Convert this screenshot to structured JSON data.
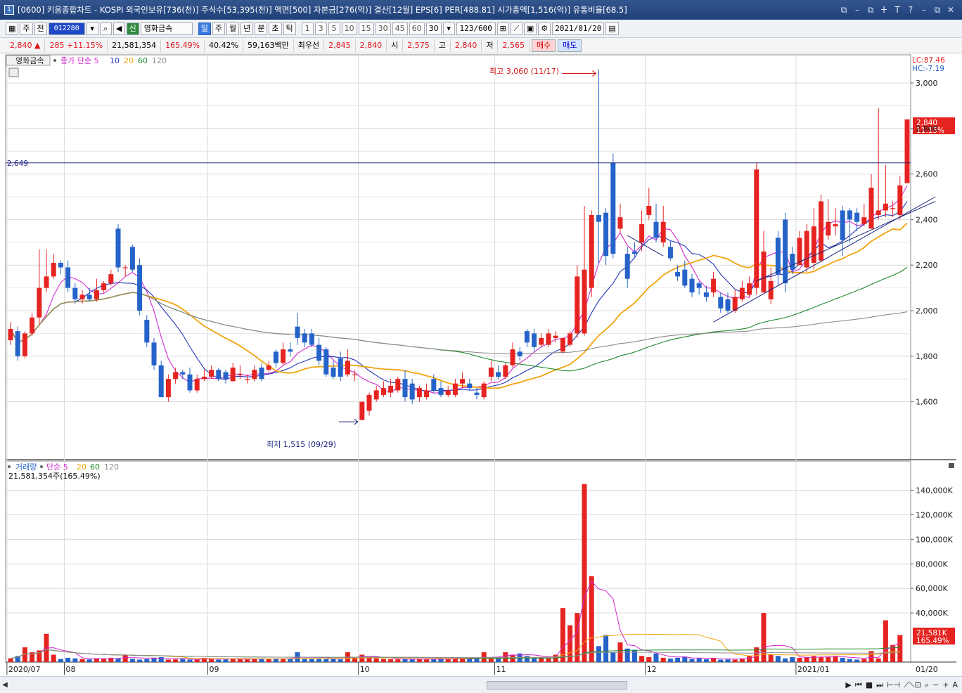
{
  "window": {
    "title": "[0600] 키움종합차트 - KOSPI 외국인보유[736(천)] 주식수[53,395(천)] 액면[500] 자본금[276(억)] 결산[12월] EPS[6] PER[488.81] 시가총액[1,516(억)] 유통비율[68.5]",
    "app_badge": "1",
    "controls": [
      "⧉",
      "–",
      "⧉",
      "ⵜ",
      "T",
      "?",
      "–",
      "⧉",
      "✕"
    ]
  },
  "toolbar": {
    "type": "주",
    "prev": "전",
    "code": "012280",
    "name_tag": "신",
    "name": "영화금속",
    "periods": [
      "일",
      "주",
      "월",
      "년",
      "분",
      "초",
      "틱"
    ],
    "active_period": "일",
    "intervals": [
      "1",
      "3",
      "5",
      "10",
      "15",
      "30",
      "45",
      "60"
    ],
    "interval_value": "30",
    "count": "123/600",
    "date": "2021/01/20"
  },
  "quote": {
    "price": "2,840 ▲",
    "change": "285 +11.15%",
    "volume": "21,581,354",
    "volume_ratio": "165.49%",
    "turnover": "40.42%",
    "amount": "59,163백만",
    "priority_label": "최우선",
    "ask": "2,845",
    "bid": "2,840",
    "open_label": "시",
    "open": "2,575",
    "high_label": "고",
    "high": "2,840",
    "low_label": "저",
    "low": "2,565",
    "buy_label": "매수",
    "sell_label": "매도"
  },
  "colors": {
    "up": "#e52421",
    "down": "#2563c9",
    "ma5": "#d02ad0",
    "ma10": "#2537b8",
    "ma20": "#f0a410",
    "ma60": "#1f8a2a",
    "ma120": "#8c8c8c",
    "hline": "#1a237e"
  },
  "price_panel": {
    "legend_name": "영화금속",
    "legend_ma": [
      "종가 단순 5",
      "10",
      "20",
      "60",
      "120"
    ],
    "lc": "LC:87.46",
    "hc": "HC:-7.19",
    "hline_value": 2649,
    "hline_label": "2,649",
    "high_annotation": "최고 3,060 (11/17)",
    "low_annotation": "최저 1,515 (09/29)",
    "last_price_label": "2,840",
    "last_change_label": "11.15%",
    "y_ticks": [
      "3,000",
      "2,800",
      "2,600",
      "2,400",
      "2,200",
      "2,000",
      "1,800",
      "1,600"
    ]
  },
  "volume_panel": {
    "legend_name": "거래량",
    "legend_ma": [
      "단순 5",
      "20",
      "60",
      "120"
    ],
    "current": "21,581,354주(165.49%)",
    "last_label": "21,581K",
    "last_ratio": "165.49%",
    "y_ticks": [
      "140,000K",
      "120,000K",
      "100,000K",
      "80,000K",
      "60,000K",
      "40,000K"
    ]
  },
  "x_labels": [
    "2020/07",
    "08",
    "09",
    "10",
    "11",
    "12",
    "2021/01",
    "01/20"
  ],
  "chart_data": {
    "type": "candlestick",
    "ylim": [
      1500,
      3000
    ],
    "volume_ylim": [
      0,
      150000
    ],
    "months": [
      {
        "label": "2020/07",
        "start_index": 0
      },
      {
        "label": "08",
        "start_index": 8
      },
      {
        "label": "09",
        "start_index": 28
      },
      {
        "label": "10",
        "start_index": 49
      },
      {
        "label": "11",
        "start_index": 68
      },
      {
        "label": "12",
        "start_index": 89
      },
      {
        "label": "2021/01",
        "start_index": 110
      }
    ],
    "open": [
      1870,
      1910,
      1800,
      1900,
      1970,
      2100,
      2150,
      2210,
      2190,
      2100,
      2050,
      2070,
      2050,
      2090,
      2120,
      2360,
      2190,
      2280,
      2200,
      1960,
      1860,
      1760,
      1620,
      1700,
      1730,
      1720,
      1650,
      1700,
      1710,
      1740,
      1730,
      1690,
      1720,
      1700,
      1700,
      1750,
      1740,
      1820,
      1770,
      1830,
      1930,
      1900,
      1900,
      1850,
      1830,
      1750,
      1790,
      1720,
      1720,
      1520,
      1560,
      1610,
      1630,
      1640,
      1650,
      1700,
      1680,
      1620,
      1620,
      1700,
      1660,
      1630,
      1630,
      1680,
      1680,
      1640,
      1620,
      1710,
      1730,
      1710,
      1760,
      1820,
      1910,
      1900,
      1850,
      1850,
      1880,
      1820,
      1850,
      1900,
      1900,
      2100,
      2420,
      2430,
      2650,
      2360,
      2250,
      2260,
      2300,
      2420,
      2390,
      2300,
      2280,
      2170,
      2180,
      2140,
      2120,
      2080,
      2080,
      2060,
      2050,
      2000,
      2050,
      2070,
      2100,
      2080,
      2050,
      2320,
      2400,
      2250,
      2200,
      2190,
      2210,
      2220,
      2330,
      2370,
      2440,
      2440,
      2430,
      2380,
      2360,
      2420,
      2440,
      2450,
      2420,
      2560
    ],
    "close": [
      1920,
      1800,
      1900,
      1970,
      2100,
      2150,
      2210,
      2190,
      2100,
      2050,
      2070,
      2050,
      2090,
      2120,
      2160,
      2190,
      2190,
      2180,
      2000,
      1860,
      1760,
      1620,
      1700,
      1730,
      1720,
      1650,
      1700,
      1710,
      1740,
      1700,
      1700,
      1750,
      1720,
      1700,
      1740,
      1700,
      1760,
      1770,
      1830,
      1820,
      1880,
      1860,
      1850,
      1780,
      1720,
      1710,
      1710,
      1780,
      1720,
      1600,
      1630,
      1650,
      1660,
      1670,
      1700,
      1620,
      1610,
      1660,
      1650,
      1650,
      1630,
      1650,
      1680,
      1700,
      1660,
      1630,
      1680,
      1750,
      1710,
      1760,
      1830,
      1800,
      1860,
      1840,
      1880,
      1900,
      1890,
      1880,
      1900,
      2150,
      2180,
      2420,
      2390,
      2240,
      2250,
      2410,
      2140,
      2250,
      2380,
      2460,
      2320,
      2390,
      2230,
      2150,
      2110,
      2080,
      2100,
      2060,
      2140,
      2010,
      2000,
      2060,
      2100,
      2120,
      2620,
      2260,
      2130,
      2160,
      2120,
      2180,
      2320,
      2350,
      2370,
      2480,
      2390,
      2380,
      2310,
      2400,
      2390,
      2410,
      2540,
      2440,
      2470,
      2450,
      2550,
      2840
    ],
    "high": [
      1950,
      1930,
      1910,
      1990,
      2270,
      2270,
      2250,
      2220,
      2220,
      2120,
      2090,
      2100,
      2140,
      2130,
      2180,
      2380,
      2200,
      2290,
      2230,
      1980,
      1880,
      1780,
      1720,
      1750,
      1740,
      1750,
      1720,
      1740,
      1760,
      1750,
      1740,
      1770,
      1760,
      1720,
      1760,
      1770,
      1780,
      1830,
      1860,
      1860,
      1990,
      1920,
      1920,
      1880,
      1840,
      1780,
      1820,
      1830,
      1740,
      1550,
      1640,
      1670,
      1690,
      1700,
      1710,
      1740,
      1700,
      1670,
      1680,
      1720,
      1690,
      1670,
      1700,
      1730,
      1700,
      1660,
      1690,
      1780,
      1760,
      1770,
      1860,
      1840,
      1920,
      1920,
      1900,
      1920,
      1910,
      1860,
      1910,
      2200,
      2460,
      2440,
      3060,
      2450,
      2690,
      2470,
      2280,
      2300,
      2440,
      2540,
      2470,
      2460,
      2310,
      2200,
      2220,
      2160,
      2130,
      2110,
      2170,
      2080,
      2080,
      2090,
      2130,
      2150,
      2650,
      2350,
      2190,
      2350,
      2430,
      2280,
      2350,
      2380,
      2450,
      2510,
      2490,
      2450,
      2460,
      2450,
      2450,
      2470,
      2600,
      2890,
      2640,
      2480,
      2590,
      2840
    ],
    "low": [
      1850,
      1780,
      1790,
      1890,
      1940,
      2080,
      2140,
      2160,
      2080,
      2030,
      2030,
      2040,
      2040,
      2080,
      2110,
      2170,
      2150,
      2170,
      1980,
      1840,
      1740,
      1620,
      1600,
      1680,
      1700,
      1640,
      1640,
      1690,
      1700,
      1690,
      1680,
      1690,
      1700,
      1680,
      1690,
      1690,
      1730,
      1750,
      1760,
      1800,
      1850,
      1840,
      1840,
      1760,
      1710,
      1700,
      1690,
      1710,
      1690,
      1520,
      1540,
      1600,
      1620,
      1620,
      1640,
      1600,
      1590,
      1600,
      1610,
      1640,
      1620,
      1620,
      1620,
      1660,
      1650,
      1610,
      1610,
      1690,
      1700,
      1700,
      1750,
      1780,
      1840,
      1820,
      1840,
      1840,
      1860,
      1810,
      1840,
      1880,
      1890,
      2060,
      2210,
      2200,
      2230,
      2340,
      2100,
      2230,
      2260,
      2400,
      2300,
      2280,
      2220,
      2130,
      2100,
      2060,
      2070,
      2040,
      2060,
      1990,
      1990,
      1990,
      2040,
      2060,
      2070,
      2080,
      2030,
      2110,
      2080,
      2160,
      2200,
      2170,
      2180,
      2210,
      2310,
      2330,
      2240,
      2300,
      2350,
      2370,
      2400,
      2400,
      2410,
      2410,
      2400,
      2560
    ],
    "volume": [
      3000,
      5000,
      12000,
      8000,
      9500,
      23000,
      6000,
      2500,
      3500,
      3000,
      2500,
      2200,
      3000,
      2800,
      3500,
      3000,
      6000,
      2500,
      2000,
      2500,
      3500,
      4000,
      2000,
      2200,
      2500,
      2000,
      2300,
      3500,
      2500,
      2000,
      2200,
      3000,
      2500,
      2200,
      2300,
      3000,
      2800,
      3000,
      2500,
      2800,
      8000,
      3000,
      2500,
      2700,
      2500,
      3000,
      2200,
      8000,
      3500,
      6000,
      3200,
      3000,
      2500,
      2300,
      2200,
      2500,
      2300,
      2500,
      2200,
      2500,
      2800,
      2300,
      3000,
      2500,
      3000,
      2600,
      8000,
      3000,
      4000,
      8000,
      6000,
      7000,
      5000,
      3000,
      4000,
      3000,
      6000,
      44000,
      30000,
      40000,
      145000,
      70000,
      13000,
      22000,
      8000,
      16000,
      11000,
      10000,
      5000,
      4000,
      7000,
      3500,
      2800,
      3500,
      4500,
      2500,
      3000,
      2300,
      3500,
      2000,
      2200,
      2000,
      3000,
      5000,
      12000,
      40000,
      6000,
      5000,
      3000,
      4000,
      3500,
      4000,
      5000,
      4000,
      4500,
      5000,
      3500,
      2500,
      2000,
      2500,
      9000,
      3000,
      34000,
      14000,
      22000
    ],
    "hline": 2649
  }
}
